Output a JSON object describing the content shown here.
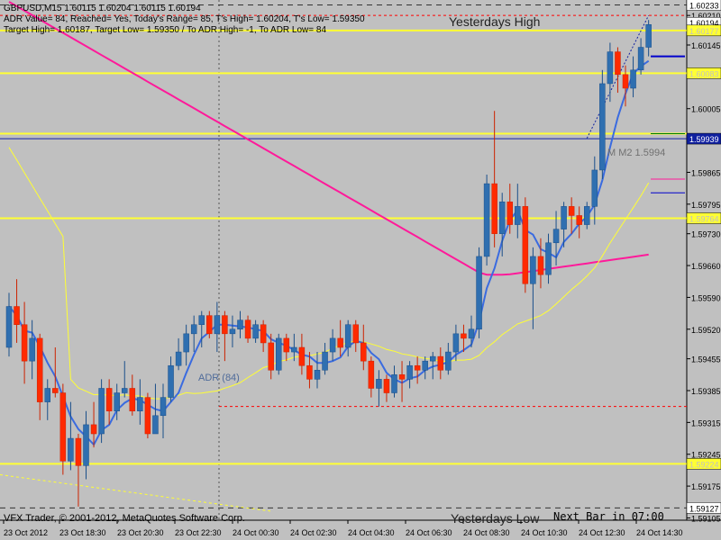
{
  "header": {
    "line1": "GBPUSD,M15  1.60115 1.60204 1.60115 1.60194",
    "line2": "ADR Value= 84, Reached= Yes, Today's Range= 85, T's High= 1.60204, T's Low= 1.59350",
    "line3": "Target High= 1.60187, Target Low= 1.59350 / To ADR High= -1, To ADR Low= 84"
  },
  "labels": {
    "yesterdays_high": "Yesterdays High",
    "yesterdays_low": "Yesterdays Low",
    "adr": "ADR (84)",
    "mm2": "M M2 1.5994",
    "copyright": "VFX Trader, © 2001-2012, MetaQuotes Software Corp.",
    "next_bar": "Next Bar in 07:00"
  },
  "colors": {
    "background": "#c0c0c0",
    "bull_candle": "#2f6fb0",
    "bear_candle": "#ff2a00",
    "ma_fast": "#3a6be0",
    "ma_slow": "#ffff33",
    "ma_trend": "#ff1a9a",
    "level_yellow": "#ffff33",
    "level_blue": "#1020a0",
    "dashed_red": "#ff0000",
    "axis_text": "#000000"
  },
  "chart_data": {
    "type": "candlestick",
    "symbol": "GBPUSD",
    "timeframe": "M15",
    "ylim": [
      1.591,
      1.6024
    ],
    "y_ticks": [
      "1.60210",
      "1.60145",
      "1.60080",
      "1.60005",
      "1.59935",
      "1.59865",
      "1.59795",
      "1.59730",
      "1.59660",
      "1.59590",
      "1.59520",
      "1.59455",
      "1.59385",
      "1.59315",
      "1.59245",
      "1.59175",
      "1.59105"
    ],
    "x_tick_labels": [
      "23 Oct 2012",
      "23 Oct 18:30",
      "23 Oct 20:30",
      "23 Oct 22:30",
      "24 Oct 00:30",
      "24 Oct 02:30",
      "24 Oct 04:30",
      "24 Oct 06:30",
      "24 Oct 08:30",
      "24 Oct 10:30",
      "24 Oct 12:30",
      "24 Oct 14:30"
    ],
    "price_tags": [
      {
        "text": "1.60233",
        "value": 1.60233,
        "style": "white"
      },
      {
        "text": "1.60194",
        "value": 1.60194,
        "style": "white"
      },
      {
        "text": "1.60177",
        "value": 1.60177,
        "style": "yellow"
      },
      {
        "text": "1.60083",
        "value": 1.60083,
        "style": "yellow"
      },
      {
        "text": "1.59939",
        "value": 1.59939,
        "style": "blue"
      },
      {
        "text": "1.59764",
        "value": 1.59764,
        "style": "yellow"
      },
      {
        "text": "1.59224",
        "value": 1.59224,
        "style": "yellow"
      },
      {
        "text": "1.59127",
        "value": 1.59127,
        "style": "white"
      }
    ],
    "horizontal_levels": [
      {
        "name": "yesterdays-high",
        "value": 1.60233,
        "style": "dashed-gray"
      },
      {
        "name": "target-high",
        "value": 1.6021,
        "style": "dashed-red"
      },
      {
        "name": "adr-high",
        "value": 1.60177,
        "style": "yellow"
      },
      {
        "name": "level-1",
        "value": 1.60083,
        "style": "yellow"
      },
      {
        "name": "level-2",
        "value": 1.5995,
        "style": "yellow"
      },
      {
        "name": "bid",
        "value": 1.59939,
        "style": "blue"
      },
      {
        "name": "level-3",
        "value": 1.59764,
        "style": "yellow"
      },
      {
        "name": "adr-low-target",
        "value": 1.5935,
        "style": "dashed-red"
      },
      {
        "name": "level-4",
        "value": 1.59224,
        "style": "yellow"
      },
      {
        "name": "yesterdays-low",
        "value": 1.59127,
        "style": "dashed-gray"
      }
    ],
    "candles": [
      [
        1.5948,
        1.596,
        1.5946,
        1.5957
      ],
      [
        1.5957,
        1.5963,
        1.5949,
        1.5953
      ],
      [
        1.5953,
        1.5958,
        1.594,
        1.5945
      ],
      [
        1.5945,
        1.5954,
        1.5941,
        1.595
      ],
      [
        1.595,
        1.5951,
        1.5932,
        1.5936
      ],
      [
        1.5936,
        1.5941,
        1.5932,
        1.5939
      ],
      [
        1.5939,
        1.5948,
        1.5937,
        1.5938
      ],
      [
        1.5938,
        1.594,
        1.592,
        1.5923
      ],
      [
        1.5923,
        1.5936,
        1.5921,
        1.5928
      ],
      [
        1.5928,
        1.5929,
        1.5913,
        1.5922
      ],
      [
        1.5922,
        1.5934,
        1.5919,
        1.5931
      ],
      [
        1.5931,
        1.5936,
        1.5926,
        1.5929
      ],
      [
        1.5929,
        1.5941,
        1.5927,
        1.5939
      ],
      [
        1.5939,
        1.5941,
        1.5931,
        1.5934
      ],
      [
        1.5934,
        1.594,
        1.5932,
        1.5938
      ],
      [
        1.5938,
        1.5945,
        1.5937,
        1.5939
      ],
      [
        1.5939,
        1.5942,
        1.5933,
        1.5934
      ],
      [
        1.5934,
        1.5941,
        1.5931,
        1.5937
      ],
      [
        1.5937,
        1.5938,
        1.5928,
        1.5929
      ],
      [
        1.5929,
        1.594,
        1.5929,
        1.5933
      ],
      [
        1.5933,
        1.594,
        1.5928,
        1.5937
      ],
      [
        1.5937,
        1.5946,
        1.5936,
        1.5944
      ],
      [
        1.5944,
        1.595,
        1.5943,
        1.5947
      ],
      [
        1.5947,
        1.5953,
        1.5944,
        1.5951
      ],
      [
        1.5951,
        1.5955,
        1.5947,
        1.5953
      ],
      [
        1.5953,
        1.5956,
        1.5948,
        1.5955
      ],
      [
        1.5955,
        1.5956,
        1.595,
        1.5951
      ],
      [
        1.5951,
        1.5958,
        1.5947,
        1.5955
      ],
      [
        1.5955,
        1.5956,
        1.5945,
        1.5951
      ],
      [
        1.5951,
        1.5955,
        1.5948,
        1.5952
      ],
      [
        1.5952,
        1.5956,
        1.595,
        1.5954
      ],
      [
        1.5954,
        1.5955,
        1.5949,
        1.595
      ],
      [
        1.595,
        1.5954,
        1.5949,
        1.5953
      ],
      [
        1.5953,
        1.5954,
        1.5947,
        1.5949
      ],
      [
        1.5949,
        1.5951,
        1.5941,
        1.5943
      ],
      [
        1.5943,
        1.5951,
        1.5942,
        1.595
      ],
      [
        1.595,
        1.5951,
        1.5945,
        1.5947
      ],
      [
        1.5947,
        1.5951,
        1.5945,
        1.5948
      ],
      [
        1.5948,
        1.5951,
        1.5942,
        1.5944
      ],
      [
        1.5944,
        1.5947,
        1.5939,
        1.5941
      ],
      [
        1.5941,
        1.5947,
        1.5939,
        1.5943
      ],
      [
        1.5943,
        1.5949,
        1.5942,
        1.5947
      ],
      [
        1.5947,
        1.5952,
        1.5945,
        1.595
      ],
      [
        1.595,
        1.5954,
        1.5946,
        1.5948
      ],
      [
        1.5948,
        1.5954,
        1.5946,
        1.5953
      ],
      [
        1.5953,
        1.5954,
        1.5947,
        1.5949
      ],
      [
        1.5949,
        1.5953,
        1.5943,
        1.5945
      ],
      [
        1.5945,
        1.5946,
        1.5937,
        1.5939
      ],
      [
        1.5939,
        1.5943,
        1.5935,
        1.5941
      ],
      [
        1.5941,
        1.5942,
        1.5936,
        1.5938
      ],
      [
        1.5938,
        1.5944,
        1.5937,
        1.5942
      ],
      [
        1.5942,
        1.5945,
        1.5936,
        1.5941
      ],
      [
        1.5941,
        1.5945,
        1.5939,
        1.5944
      ],
      [
        1.5944,
        1.5946,
        1.594,
        1.5943
      ],
      [
        1.5943,
        1.5946,
        1.5941,
        1.5945
      ],
      [
        1.5945,
        1.5947,
        1.5941,
        1.5946
      ],
      [
        1.5946,
        1.5948,
        1.5941,
        1.5943
      ],
      [
        1.5943,
        1.5949,
        1.5942,
        1.5947
      ],
      [
        1.5947,
        1.5953,
        1.5945,
        1.5951
      ],
      [
        1.5951,
        1.5953,
        1.5947,
        1.595
      ],
      [
        1.595,
        1.5955,
        1.5948,
        1.5952
      ],
      [
        1.5952,
        1.597,
        1.595,
        1.5968
      ],
      [
        1.5968,
        1.5986,
        1.5966,
        1.5984
      ],
      [
        1.5984,
        1.6,
        1.597,
        1.5973
      ],
      [
        1.5973,
        1.5982,
        1.5968,
        1.598
      ],
      [
        1.598,
        1.5984,
        1.5973,
        1.5975
      ],
      [
        1.5975,
        1.5984,
        1.5972,
        1.5979
      ],
      [
        1.5979,
        1.5981,
        1.596,
        1.5962
      ],
      [
        1.5962,
        1.597,
        1.5952,
        1.5968
      ],
      [
        1.5968,
        1.5972,
        1.5961,
        1.5964
      ],
      [
        1.5964,
        1.5973,
        1.5962,
        1.5971
      ],
      [
        1.5971,
        1.5978,
        1.5966,
        1.5974
      ],
      [
        1.5974,
        1.598,
        1.597,
        1.5979
      ],
      [
        1.5979,
        1.5981,
        1.5973,
        1.5977
      ],
      [
        1.5977,
        1.5979,
        1.5972,
        1.5975
      ],
      [
        1.5975,
        1.598,
        1.5974,
        1.5979
      ],
      [
        1.5979,
        1.599,
        1.5975,
        1.5987
      ],
      [
        1.5987,
        1.6009,
        1.5985,
        1.6006
      ],
      [
        1.6006,
        1.6015,
        1.6002,
        1.6013
      ],
      [
        1.6013,
        1.6014,
        1.6004,
        1.6008
      ],
      [
        1.6008,
        1.601,
        1.6001,
        1.6005
      ],
      [
        1.6005,
        1.6012,
        1.6003,
        1.6009
      ],
      [
        1.6009,
        1.6016,
        1.6008,
        1.6014
      ],
      [
        1.6014,
        1.602,
        1.6012,
        1.6019
      ]
    ]
  }
}
